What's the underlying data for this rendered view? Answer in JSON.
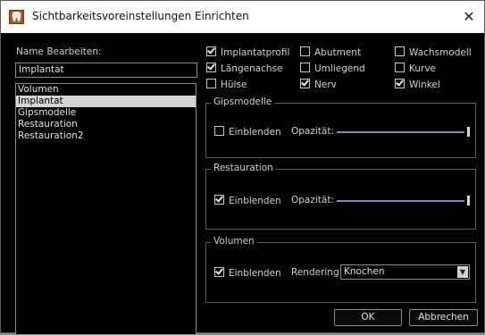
{
  "window": {
    "title": "Sichtbarkeitsvoreinstellungen Einrichten",
    "icon": "tooth-app-icon",
    "close_glyph": "✕"
  },
  "left": {
    "name_label": "Name Bearbeiten:",
    "name_value": "Implantat",
    "list_items": [
      "Volumen",
      "Implantat",
      "Gipsmodelle",
      "Restauration",
      "Restauration2"
    ],
    "selected_index": 1
  },
  "checkboxes": {
    "implantatprofil": {
      "label": "Implantatprofil",
      "checked": true
    },
    "abutment": {
      "label": "Abutment",
      "checked": false
    },
    "wachsmodell": {
      "label": "Wachsmodell",
      "checked": false
    },
    "laengenachse": {
      "label": "Längenachse",
      "checked": true
    },
    "umliegend": {
      "label": "Umliegend",
      "checked": false
    },
    "kurve": {
      "label": "Kurve",
      "checked": false
    },
    "huelse": {
      "label": "Hülse",
      "checked": false
    },
    "nerv": {
      "label": "Nerv",
      "checked": true
    },
    "winkel": {
      "label": "Winkel",
      "checked": true
    }
  },
  "groups": {
    "gipsmodelle": {
      "title": "Gipsmodelle",
      "show_label": "Einblenden",
      "show_checked": false,
      "opacity_label": "Opazität:",
      "opacity_value": 1.0
    },
    "restauration": {
      "title": "Restauration",
      "show_label": "Einblenden",
      "show_checked": true,
      "opacity_label": "Opazität:",
      "opacity_value": 1.0
    },
    "volumen": {
      "title": "Volumen",
      "show_label": "Einblenden",
      "show_checked": true,
      "rendering_label": "Rendering:",
      "rendering_value": "Knochen"
    }
  },
  "buttons": {
    "ok": "OK",
    "cancel": "Abbrechen"
  },
  "colors": {
    "background": "#000000",
    "slider_track": "#8b82b8",
    "selection": "#d4d4d4"
  }
}
